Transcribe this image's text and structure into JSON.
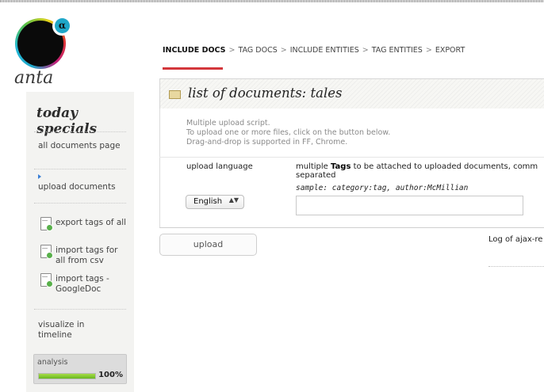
{
  "brand": {
    "name": "anta",
    "logo_symbol": "α",
    "logo_colors": [
      "#1fa7c9",
      "#55c04a",
      "#e6d21a",
      "#e0372e",
      "#c21f7a"
    ]
  },
  "sidebar": {
    "title": "today specials",
    "items": [
      {
        "label": "all documents page",
        "icon": ""
      },
      {
        "label": "upload documents",
        "icon": "pointer-arrow-icon"
      },
      {
        "label": "export tags of all",
        "icon": "document-export-icon"
      },
      {
        "label": "import tags for all from csv",
        "icon": "document-import-icon"
      },
      {
        "label": "import tags - GoogleDoc",
        "icon": "document-import-icon"
      },
      {
        "label": "visualize in timeline",
        "icon": ""
      }
    ],
    "analysis": {
      "label": "analysis",
      "percent_text": "100%",
      "progress": 1.0,
      "bar_color": "#69b81f"
    }
  },
  "breadcrumbs": {
    "items": [
      "INCLUDE DOCS",
      "TAG DOCS",
      "INCLUDE ENTITIES",
      "TAG ENTITIES",
      "EXPORT"
    ],
    "separator": ">",
    "active_index": 0,
    "active_color": "#d3363b"
  },
  "panel": {
    "title": "list of documents: tales",
    "instructions": [
      "Multiple upload script.",
      "To upload one or more files, click on the button below.",
      "Drag-and-drop is supported in FF, Chrome."
    ],
    "upload_language_label": "upload language",
    "language_selected": "English",
    "tags_desc_prefix": "multiple ",
    "tags_desc_bold": "Tags",
    "tags_desc_suffix": " to be attached to uploaded documents, comm",
    "tags_desc_line2": "separated",
    "tags_sample_label": "sample:",
    "tags_sample_value": "category:tag, author:McMillian",
    "tags_input_value": "",
    "upload_button": "upload",
    "log_label": "Log of ajax-re"
  }
}
